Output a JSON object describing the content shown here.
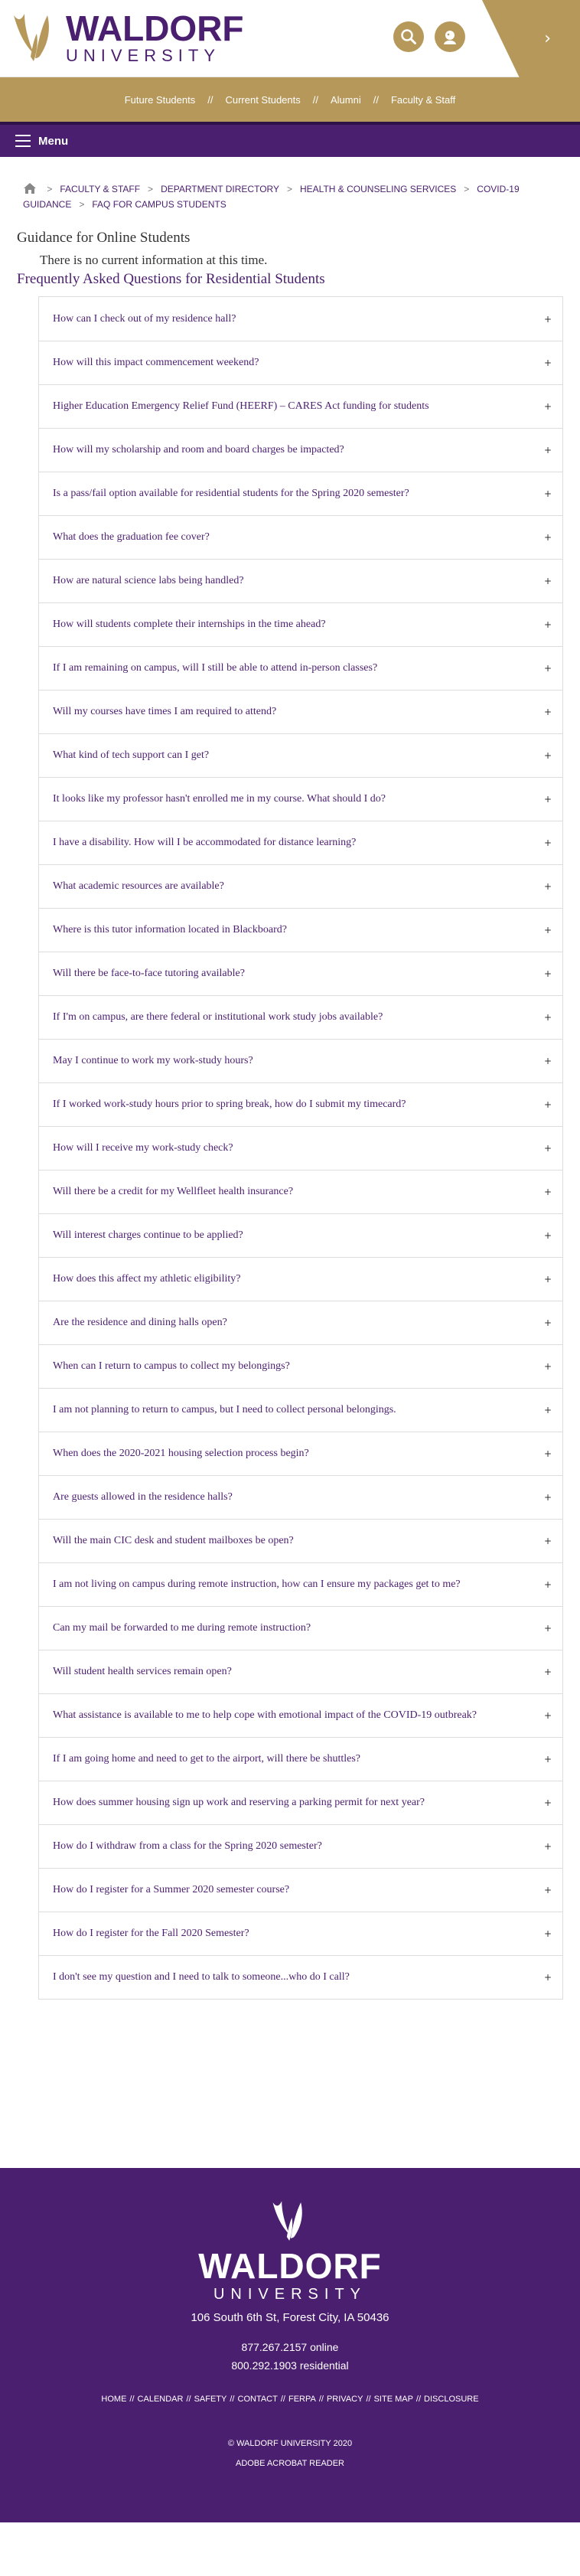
{
  "header": {
    "logo_title": "WALDORF",
    "logo_subtitle": "UNIVERSITY",
    "colors": {
      "purple": "#4b1f6f",
      "gold": "#b5985a"
    },
    "icons": [
      "search-icon",
      "user-icon",
      "chevron-right-icon"
    ]
  },
  "gold_nav": {
    "items": [
      {
        "label": "Future Students"
      },
      {
        "label": "Current Students"
      },
      {
        "label": "Alumni"
      },
      {
        "label": "Faculty & Staff"
      }
    ],
    "separator": "//"
  },
  "menu": {
    "label": "Menu"
  },
  "breadcrumb": {
    "items": [
      {
        "label": "FACULTY & STAFF"
      },
      {
        "label": "DEPARTMENT DIRECTORY"
      },
      {
        "label": "HEALTH & COUNSELING SERVICES"
      },
      {
        "label": "COVID-19 GUIDANCE"
      },
      {
        "label": "FAQ FOR CAMPUS STUDENTS"
      }
    ],
    "separator": ">"
  },
  "main": {
    "online_heading": "Guidance for Online Students",
    "online_text": "There is no current information at this time.",
    "faq_heading": "Frequently Asked Questions for Residential Students",
    "faq_items": [
      "How can I check out of my residence hall?",
      "How will this impact commencement weekend?",
      "Higher Education Emergency Relief Fund (HEERF) – CARES Act funding for students",
      "How will my scholarship and room and board charges be impacted?",
      "Is a pass/fail option available for residential students for the Spring 2020 semester?",
      "What does the graduation fee cover?",
      "How are natural science labs being handled?",
      "How will students complete their internships in the time ahead?",
      "If I am remaining on campus, will I still be able to attend in-person classes?",
      "Will my courses have times I am required to attend?",
      "What kind of tech support can I get?",
      "It looks like my professor hasn't enrolled me in my course. What should I do?",
      "I have a disability. How will I be accommodated for distance learning?",
      "What academic resources are available?",
      "Where is this tutor information located in Blackboard?",
      "Will there be face-to-face tutoring available?",
      "If I'm on campus, are there federal or institutional work study jobs available?",
      "May I continue to work my work-study hours?",
      "If I worked work-study hours prior to spring break, how do I submit my timecard?",
      "How will I receive my work-study check?",
      "Will there be a credit for my Wellfleet health insurance?",
      "Will interest charges continue to be applied?",
      "How does this affect my athletic eligibility?",
      "Are the residence and dining halls open?",
      "When can I return to campus to collect my belongings?",
      "I am not planning to return to campus, but I need to collect personal belongings.",
      "When does the 2020-2021 housing selection process begin?",
      "Are guests allowed in the residence halls?",
      "Will the main CIC desk and student mailboxes be open?",
      "I am not living on campus during remote instruction, how can I ensure my packages get to me?",
      "Can my mail be forwarded to me during remote instruction?",
      "Will student health services remain open?",
      "What assistance is available to me to help cope with emotional impact of the COVID-19 outbreak?",
      "If I am going home and need to get to the airport, will there be shuttles?",
      "How does summer housing sign up work and reserving a parking permit for next year?",
      "How do I withdraw from a class for the Spring 2020 semester?",
      "How do I register for a Summer 2020 semester course?",
      "How do I register for the Fall 2020 Semester?",
      "I don't see my question and I need to talk to someone...who do I call?"
    ],
    "expand_symbol": "+"
  },
  "footer": {
    "logo_title": "WALDORF",
    "logo_subtitle": "UNIVERSITY",
    "address": "106 South 6th St, Forest City, IA 50436",
    "phone_online": "877.267.2157 online",
    "phone_residential": "800.292.1903 residential",
    "links": [
      "HOME",
      "CALENDAR",
      "SAFETY",
      "CONTACT",
      "FERPA",
      "PRIVACY",
      "SITE MAP",
      "DISCLOSURE"
    ],
    "link_separator": "//",
    "copyright": "© WALDORF UNIVERSITY 2020",
    "acrobat": "ADOBE ACROBAT READER"
  }
}
